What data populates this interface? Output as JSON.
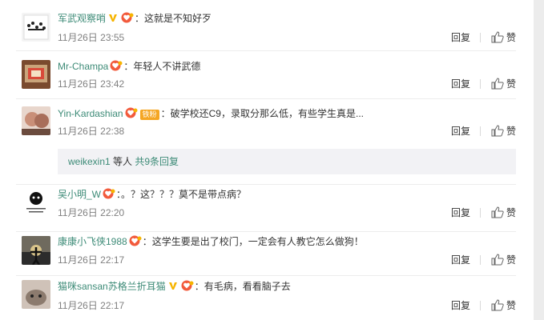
{
  "comments": [
    {
      "username": "军武观察哨",
      "verified": true,
      "text": "这就是不知好歹",
      "time": "11月26日 23:55",
      "reply_label": "回复",
      "like_label": "赞"
    },
    {
      "username": "Mr-Champa",
      "verified": false,
      "text": "年轻人不讲武德",
      "time": "11月26日 23:42",
      "reply_label": "回复",
      "like_label": "赞"
    },
    {
      "username": "Yin-Kardashian",
      "verified": false,
      "fan_badge": "铁粉",
      "text": "破学校还C9，录取分那么低，有些学生真是...",
      "time": "11月26日 22:38",
      "reply_label": "回复",
      "like_label": "赞"
    },
    {
      "username": "吴小明_W",
      "verified": false,
      "text": "。？这？？？莫不是带点病？",
      "time": "11月26日 22:20",
      "reply_label": "回复",
      "like_label": "赞"
    },
    {
      "username": "康康小飞侠1988",
      "verified": false,
      "text": "这学生要是出了校门，一定会有人教它怎么做狗！",
      "time": "11月26日 22:17",
      "reply_label": "回复",
      "like_label": "赞"
    },
    {
      "username": "猫咪sansan苏格兰折耳猫",
      "verified": true,
      "text": "有毛病，看看脑子去",
      "time": "11月26日 22:17",
      "reply_label": "回复",
      "like_label": "赞"
    }
  ],
  "subreply": {
    "user": "weikexin1",
    "middle": " 等人 ",
    "more": "共9条回复"
  },
  "colon": "：",
  "colors": {
    "username": "#3d8b77",
    "meta": "#808080",
    "divider": "#ececec",
    "subreply_bg": "#f2f2f5",
    "verified": "#f6b400",
    "heart": "#f25a3c"
  }
}
